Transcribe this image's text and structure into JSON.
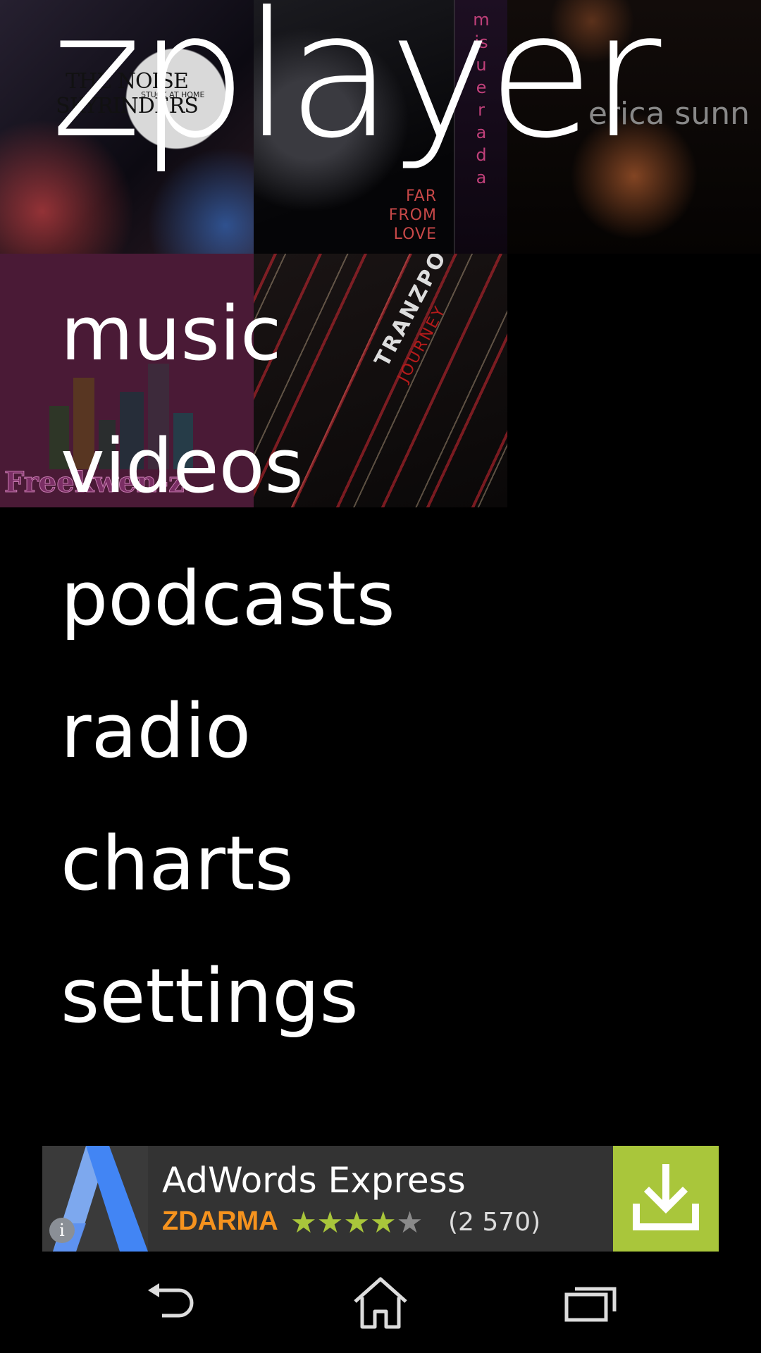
{
  "app": {
    "title": "zplayer"
  },
  "album_art": {
    "noise_band": "THE NOISE SKYRINDERS",
    "noise_album": "STUCK AT HOME",
    "far_lines": [
      "FAR",
      "FROM",
      "LOVE"
    ],
    "vertical_word": "misuerada",
    "artist_overlay": "erica sunn",
    "freek": "Freekwen-z",
    "tranz": "TRANZPOTTER",
    "journey": "JOURNEY"
  },
  "menu": {
    "items": [
      {
        "label": "music"
      },
      {
        "label": "videos"
      },
      {
        "label": "podcasts"
      },
      {
        "label": "radio"
      },
      {
        "label": "charts"
      },
      {
        "label": "settings"
      }
    ]
  },
  "ad": {
    "title": "AdWords Express",
    "price": "ZDARMA",
    "rating": 4,
    "rating_max": 5,
    "rating_count": "(2 570)",
    "info_icon": "info-icon",
    "download_icon": "download-icon",
    "colors": {
      "download_bg": "#a9c63b",
      "price": "#f6931e",
      "star": "#a9c63b"
    }
  },
  "navbar": {
    "icons": [
      "back-icon",
      "home-icon",
      "recent-apps-icon"
    ]
  }
}
